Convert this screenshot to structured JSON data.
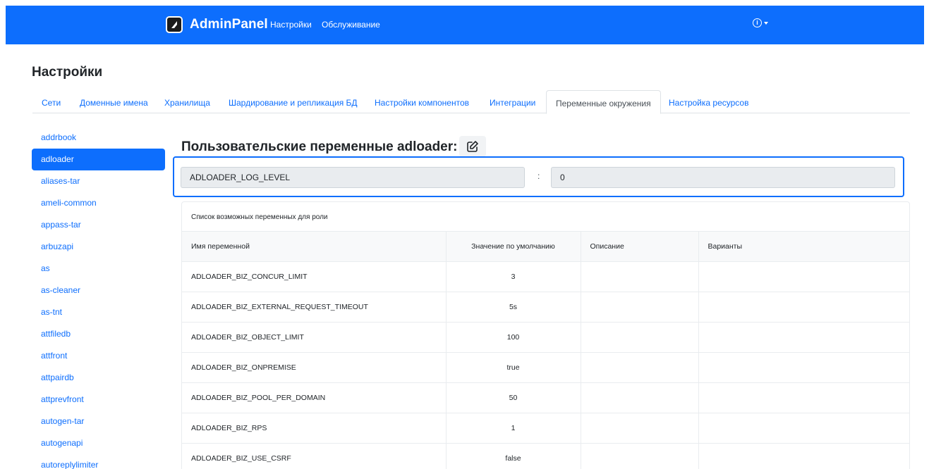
{
  "navbar": {
    "brand": "AdminPanel",
    "links": [
      "Настройки",
      "Обслуживание"
    ],
    "info_icon": "info-icon",
    "accent": "#0d6efd"
  },
  "page": {
    "title": "Настройки"
  },
  "tabs": [
    {
      "label": "Сети",
      "active": false
    },
    {
      "label": "Доменные имена",
      "active": false
    },
    {
      "label": "Хранилища",
      "active": false
    },
    {
      "label": "Шардирование и репликация БД",
      "active": false
    },
    {
      "label": "Настройки компонентов",
      "active": false
    },
    {
      "label": "Интеграции",
      "active": false
    },
    {
      "label": "Переменные окружения",
      "active": true
    },
    {
      "label": "Настройка ресурсов",
      "active": false
    }
  ],
  "sidebar": {
    "items": [
      "addrbook",
      "adloader",
      "aliases-tar",
      "ameli-common",
      "appass-tar",
      "arbuzapi",
      "as",
      "as-cleaner",
      "as-tnt",
      "attfiledb",
      "attfront",
      "attpairdb",
      "attprevfront",
      "autogen-tar",
      "autogenapi",
      "autoreplylimiter"
    ],
    "active": "adloader"
  },
  "section": {
    "title": "Пользовательские переменные adloader:",
    "edit_icon": "edit-icon"
  },
  "custom_var": {
    "name": "ADLOADER_LOG_LEVEL",
    "separator": ":",
    "value": "0"
  },
  "possible_vars": {
    "caption": "Список возможных переменных для роли",
    "columns": [
      "Имя переменной",
      "Значение по умолчанию",
      "Описание",
      "Варианты"
    ],
    "rows": [
      [
        "ADLOADER_BIZ_CONCUR_LIMIT",
        "3",
        "",
        ""
      ],
      [
        "ADLOADER_BIZ_EXTERNAL_REQUEST_TIMEOUT",
        "5s",
        "",
        ""
      ],
      [
        "ADLOADER_BIZ_OBJECT_LIMIT",
        "100",
        "",
        ""
      ],
      [
        "ADLOADER_BIZ_ONPREMISE",
        "true",
        "",
        ""
      ],
      [
        "ADLOADER_BIZ_POOL_PER_DOMAIN",
        "50",
        "",
        ""
      ],
      [
        "ADLOADER_BIZ_RPS",
        "1",
        "",
        ""
      ],
      [
        "ADLOADER_BIZ_USE_CSRF",
        "false",
        "",
        ""
      ]
    ]
  }
}
